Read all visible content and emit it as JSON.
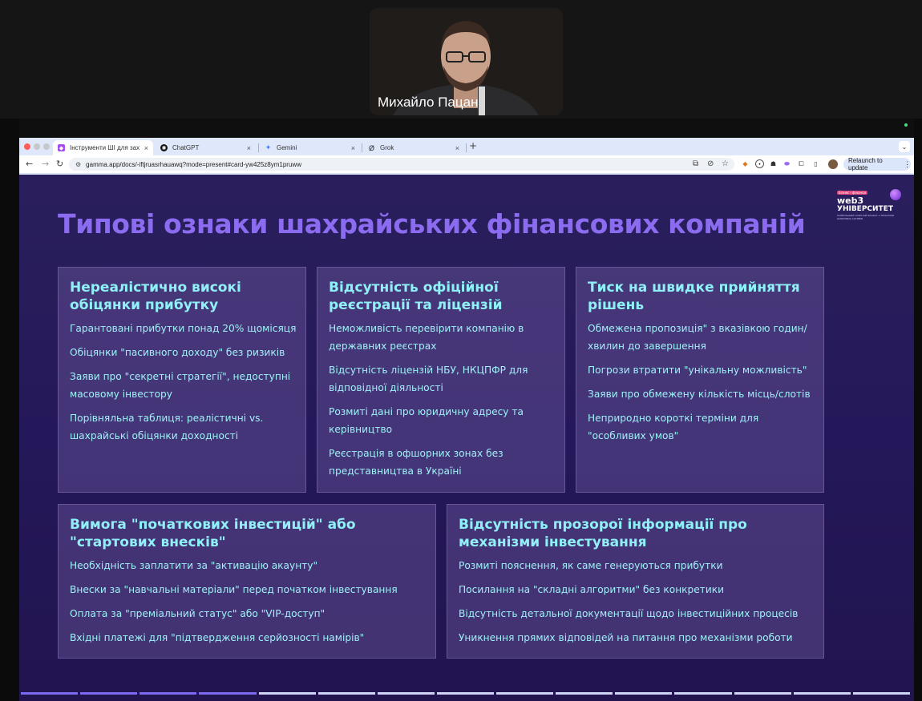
{
  "call": {
    "participant_name": "Михайло Пацан"
  },
  "browser": {
    "tabs": [
      {
        "label": "Інструменти ШІ для захисту",
        "icon": "gamma-icon",
        "active": true
      },
      {
        "label": "ChatGPT",
        "icon": "chatgpt-icon",
        "active": false
      },
      {
        "label": "Gemini",
        "icon": "gemini-icon",
        "active": false
      },
      {
        "label": "Grok",
        "icon": "grok-icon",
        "active": false
      }
    ],
    "url": "gamma.app/docs/-iftjruasrhauawq?mode=present#card-yw425z8ym1pruww",
    "relaunch_label": "Relaunch to update"
  },
  "slide": {
    "title": "Типові ознаки шахрайських фінансових компаній",
    "logo": {
      "badge": "Бізнес і фінанси",
      "learn_text": "learn to earn global",
      "line1": "web3",
      "line2": "УНІВЕРСИТЕТ",
      "subtitle": "НАЙБІЛЬШИЙ ОСВІТНІЙ ПРОЄКТ З ТЕМАТИКИ ЦИФРОВИХ АКТИВІВ"
    },
    "cards": [
      {
        "title": "Нереалістично високі обіцянки прибутку",
        "items": [
          "Гарантовані прибутки понад 20% щомісяця",
          "Обіцянки \"пасивного доходу\" без ризиків",
          "Заяви про \"секретні стратегії\", недоступні масовому інвестору",
          "Порівняльна таблиця: реалістичні vs. шахрайські обіцянки доходності"
        ]
      },
      {
        "title": "Відсутність офіційної реєстрації та ліцензій",
        "items": [
          "Неможливість перевірити компанію в державних реєстрах",
          "Відсутність ліцензій НБУ, НКЦПФР для відповідної діяльності",
          "Розмиті дані про юридичну адресу та керівництво",
          "Реєстрація в офшорних зонах без представництва в Україні"
        ]
      },
      {
        "title": "Тиск на швидке прийняття рішень",
        "items": [
          "Обмежена пропозиція\" з вказівкою годин/хвилин до завершення",
          "Погрози втратити \"унікальну можливість\"",
          "Заяви про обмежену кількість місць/слотів",
          "Неприродно короткі терміни для \"особливих умов\""
        ]
      },
      {
        "title": "Вимога \"початкових інвестицій\" або \"стартових внесків\"",
        "items": [
          "Необхідність заплатити за \"активацію акаунту\"",
          "Внески за \"навчальні матеріали\" перед початком інвестування",
          "Оплата за \"преміальний статус\" або \"VIP-доступ\"",
          "Вхідні платежі для \"підтвердження серйозності намірів\""
        ]
      },
      {
        "title": "Відсутність прозорої інформації про механізми інвестування",
        "items": [
          "Розмиті пояснення, як саме генеруються прибутки",
          "Посилання на \"складні алгоритми\" без конкретики",
          "Відсутність детальної документації щодо інвестиційних процесів",
          "Уникнення прямих відповідей на питання про механізми роботи"
        ]
      }
    ]
  },
  "progress": {
    "total_slides": 15,
    "current_slide": 4
  },
  "colors": {
    "title": "#8b6cf0",
    "card_text": "#9ef1f6",
    "card_heading": "#8ff0f7",
    "slide_bg": "#25185a",
    "progress_done": "#7b6af0",
    "progress_todo": "#cfd3f5"
  }
}
